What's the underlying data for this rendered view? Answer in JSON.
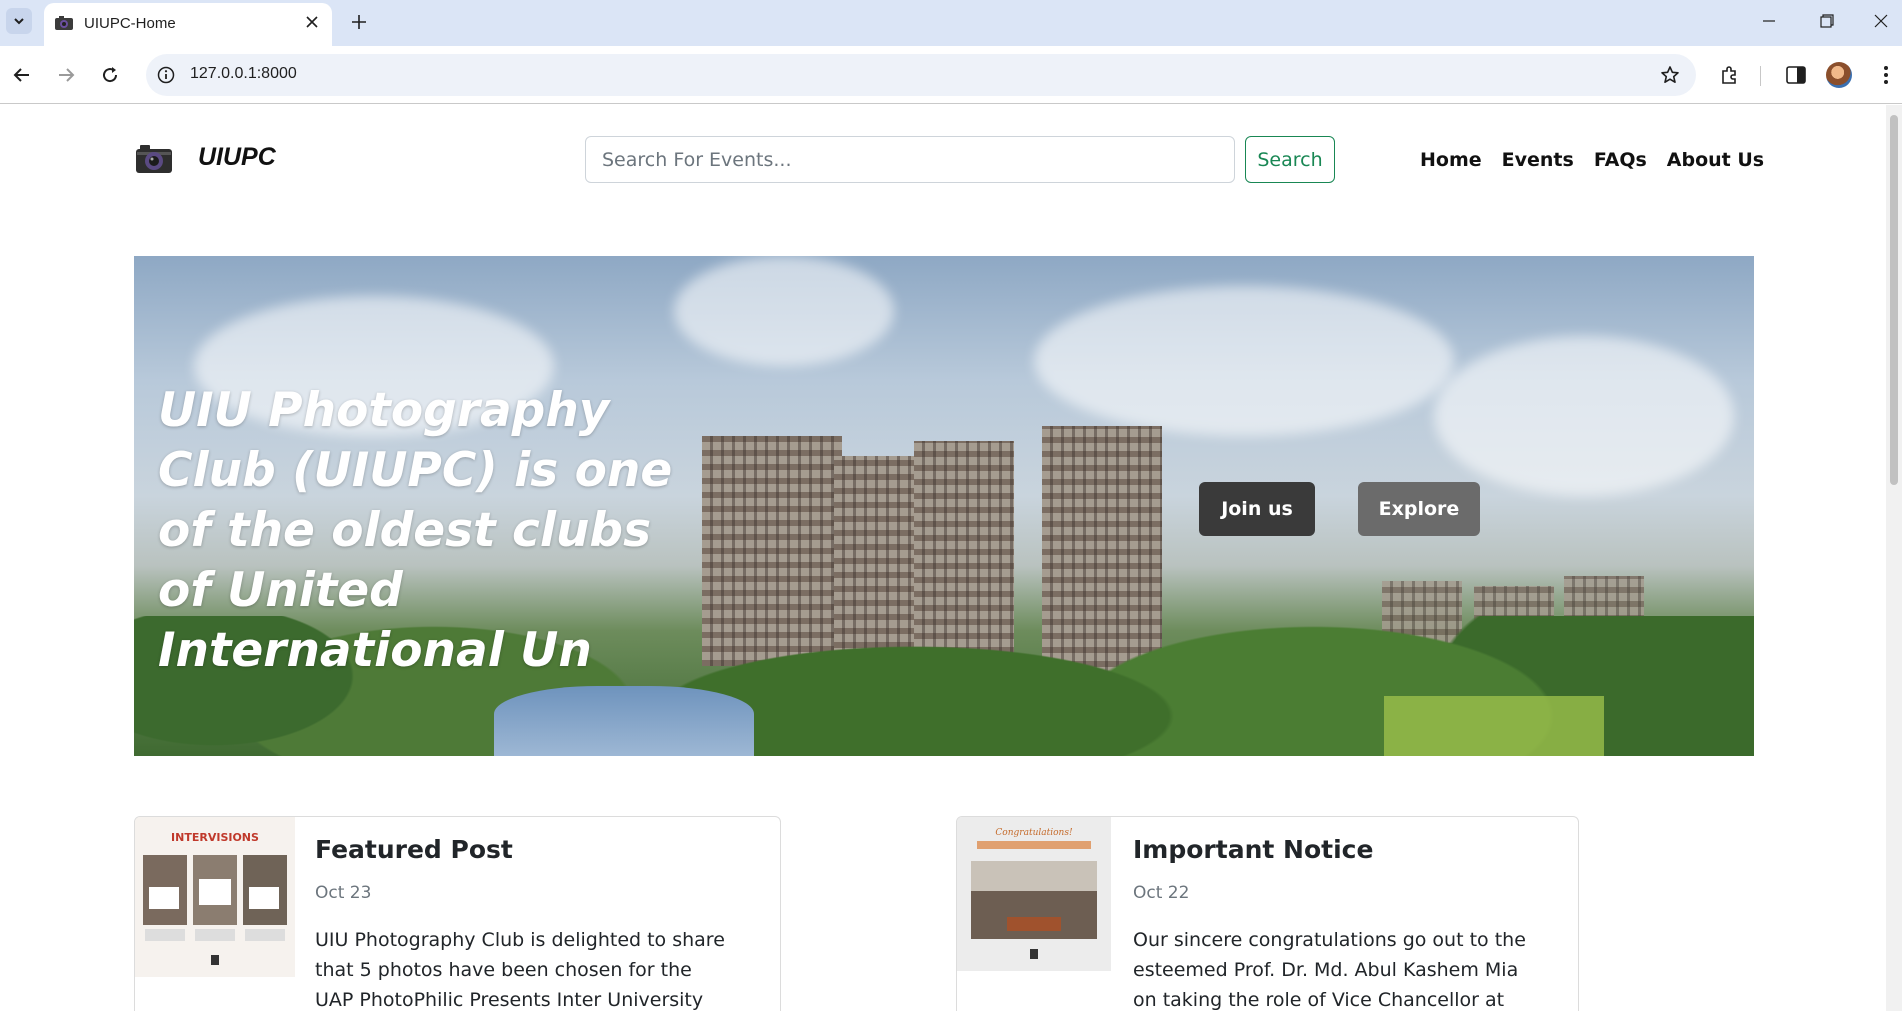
{
  "browser": {
    "tab_title": "UIUPC-Home",
    "url": "127.0.0.1:8000"
  },
  "header": {
    "brand": "UIUPC",
    "search_placeholder": "Search For Events...",
    "search_button": "Search",
    "nav": [
      "Home",
      "Events",
      "FAQs",
      "About Us"
    ]
  },
  "hero": {
    "title": "UIU Photography Club (UIUPC) is one of the oldest clubs of United International Un",
    "join_button": "Join us",
    "explore_button": "Explore"
  },
  "cards": [
    {
      "title": "Featured Post",
      "date": "Oct 23",
      "text": "UIU Photography Club is delighted to share that 5 photos have been chosen for the UAP PhotoPhilic Presents Inter University",
      "thumb_heading": "INTERVISIONS"
    },
    {
      "title": "Important Notice",
      "date": "Oct 22",
      "text": "Our sincere congratulations go out to the esteemed Prof. Dr. Md. Abul Kashem Mia on taking the role of Vice Chancellor at",
      "thumb_heading": "Congratulations!"
    }
  ],
  "colors": {
    "success": "#198754",
    "tab_strip": "#dbe5f6",
    "join_button": "#3a3a3a",
    "explore_button": "#6b6b6b"
  }
}
